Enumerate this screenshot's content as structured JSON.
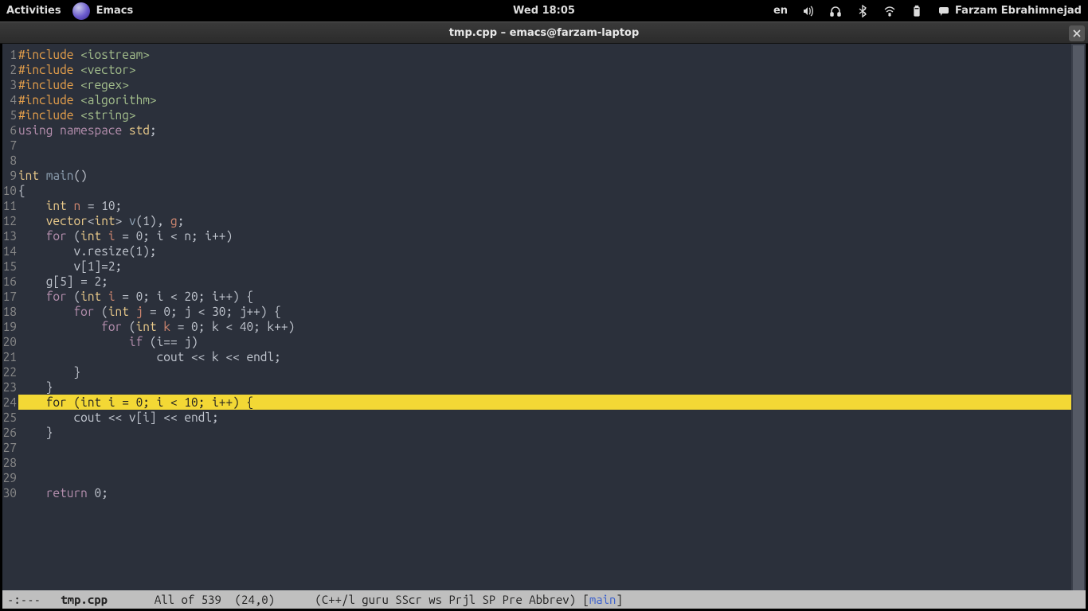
{
  "topbar": {
    "activities": "Activities",
    "app": "Emacs",
    "clock": "Wed 18:05",
    "lang": "en",
    "user": "Farzam Ebrahimnejad"
  },
  "window": {
    "title": "tmp.cpp – emacs@farzam-laptop"
  },
  "code": {
    "lines": [
      {
        "n": 1,
        "tokens": [
          [
            "pp",
            "#include "
          ],
          [
            "str",
            "<iostream>"
          ]
        ]
      },
      {
        "n": 2,
        "tokens": [
          [
            "pp",
            "#include "
          ],
          [
            "str",
            "<vector>"
          ]
        ]
      },
      {
        "n": 3,
        "tokens": [
          [
            "pp",
            "#include "
          ],
          [
            "str",
            "<regex>"
          ]
        ]
      },
      {
        "n": 4,
        "tokens": [
          [
            "pp",
            "#include "
          ],
          [
            "str",
            "<algorithm>"
          ]
        ]
      },
      {
        "n": 5,
        "tokens": [
          [
            "pp",
            "#include "
          ],
          [
            "str",
            "<string>"
          ]
        ]
      },
      {
        "n": 6,
        "tokens": [
          [
            "kw",
            "using"
          ],
          [
            "",
            " "
          ],
          [
            "kw",
            "namespace"
          ],
          [
            "",
            " "
          ],
          [
            "ty",
            "std"
          ],
          [
            "",
            "; "
          ]
        ]
      },
      {
        "n": 7,
        "tokens": [
          [
            "",
            ""
          ]
        ]
      },
      {
        "n": 8,
        "tokens": [
          [
            "",
            ""
          ]
        ]
      },
      {
        "n": 9,
        "tokens": [
          [
            "ty",
            "int"
          ],
          [
            "",
            " "
          ],
          [
            "fn",
            "main"
          ],
          [
            "",
            "()"
          ]
        ]
      },
      {
        "n": 10,
        "tokens": [
          [
            "",
            "{"
          ]
        ]
      },
      {
        "n": 11,
        "tokens": [
          [
            "",
            "    "
          ],
          [
            "ty",
            "int"
          ],
          [
            "",
            " "
          ],
          [
            "var",
            "n"
          ],
          [
            "",
            " = 10;"
          ]
        ]
      },
      {
        "n": 12,
        "tokens": [
          [
            "",
            "    "
          ],
          [
            "ty",
            "vector"
          ],
          [
            "",
            "<"
          ],
          [
            "ty",
            "int"
          ],
          [
            "",
            "> "
          ],
          [
            "fn",
            "v"
          ],
          [
            "",
            "(1), "
          ],
          [
            "var",
            "g"
          ],
          [
            "",
            ";"
          ]
        ]
      },
      {
        "n": 13,
        "tokens": [
          [
            "",
            "    "
          ],
          [
            "kw",
            "for"
          ],
          [
            "",
            " ("
          ],
          [
            "ty",
            "int"
          ],
          [
            "",
            " "
          ],
          [
            "var",
            "i"
          ],
          [
            "",
            " = 0; i < n; i++)"
          ]
        ]
      },
      {
        "n": 14,
        "tokens": [
          [
            "",
            "        v.resize(1);"
          ]
        ]
      },
      {
        "n": 15,
        "tokens": [
          [
            "",
            "        v[1]=2;"
          ]
        ]
      },
      {
        "n": 16,
        "tokens": [
          [
            "",
            "    g[5] = 2;"
          ]
        ]
      },
      {
        "n": 17,
        "tokens": [
          [
            "",
            "    "
          ],
          [
            "kw",
            "for"
          ],
          [
            "",
            " ("
          ],
          [
            "ty",
            "int"
          ],
          [
            "",
            " "
          ],
          [
            "var",
            "i"
          ],
          [
            "",
            " = 0; i < 20; i++) {"
          ]
        ]
      },
      {
        "n": 18,
        "tokens": [
          [
            "",
            "        "
          ],
          [
            "kw",
            "for"
          ],
          [
            "",
            " ("
          ],
          [
            "ty",
            "int"
          ],
          [
            "",
            " "
          ],
          [
            "var",
            "j"
          ],
          [
            "",
            " = 0; j < 30; j++) {"
          ]
        ]
      },
      {
        "n": 19,
        "tokens": [
          [
            "",
            "            "
          ],
          [
            "kw",
            "for"
          ],
          [
            "",
            " ("
          ],
          [
            "ty",
            "int"
          ],
          [
            "",
            " "
          ],
          [
            "var",
            "k"
          ],
          [
            "",
            " = 0; k < 40; k++)"
          ]
        ]
      },
      {
        "n": 20,
        "tokens": [
          [
            "",
            "                "
          ],
          [
            "kw",
            "if"
          ],
          [
            "",
            " (i== j)"
          ]
        ]
      },
      {
        "n": 21,
        "tokens": [
          [
            "",
            "                    cout << k << endl;"
          ]
        ]
      },
      {
        "n": 22,
        "tokens": [
          [
            "",
            "        }"
          ]
        ]
      },
      {
        "n": 23,
        "tokens": [
          [
            "",
            "    }"
          ]
        ]
      },
      {
        "n": 24,
        "hl": true,
        "tokens": [
          [
            "",
            "    "
          ],
          [
            "kw",
            "for"
          ],
          [
            "",
            " ("
          ],
          [
            "ty",
            "int"
          ],
          [
            "",
            " "
          ],
          [
            "var",
            "i"
          ],
          [
            "",
            " = 0; i < 10; i++) {"
          ]
        ]
      },
      {
        "n": 25,
        "tokens": [
          [
            "",
            "        cout << v[i] << endl;"
          ]
        ]
      },
      {
        "n": 26,
        "tokens": [
          [
            "",
            "    }"
          ]
        ]
      },
      {
        "n": 27,
        "tokens": [
          [
            "",
            ""
          ]
        ]
      },
      {
        "n": 28,
        "tokens": [
          [
            "",
            ""
          ]
        ]
      },
      {
        "n": 29,
        "tokens": [
          [
            "",
            ""
          ]
        ]
      },
      {
        "n": 30,
        "tokens": [
          [
            "",
            "    "
          ],
          [
            "kw",
            "return"
          ],
          [
            "",
            " 0;"
          ]
        ]
      }
    ]
  },
  "modeline": {
    "left": "-:---",
    "file": "tmp.cpp",
    "pos": "All of 539  (24,0)",
    "modes_pre": "(C++/l guru SScr ws Prjl SP Pre Abbrev) [",
    "modes_link": "main",
    "modes_post": "]"
  }
}
